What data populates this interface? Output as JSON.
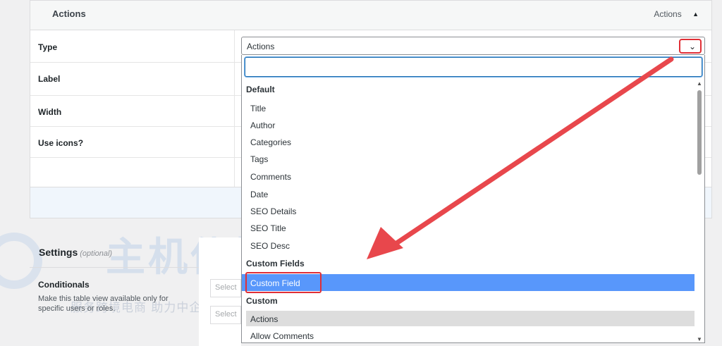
{
  "panel": {
    "title": "Actions",
    "header_right": "Actions",
    "collapse_glyph": "▲",
    "rows": [
      {
        "label": "Type"
      },
      {
        "label": "Label"
      },
      {
        "label": "Width"
      },
      {
        "label": "Use icons?"
      }
    ]
  },
  "type_select": {
    "value": "Actions",
    "chevron_glyph": "⌄",
    "search_value": "",
    "groups": [
      {
        "name": "Default",
        "options": [
          "Title",
          "Author",
          "Categories",
          "Tags",
          "Comments",
          "Date",
          "SEO Details",
          "SEO Title",
          "SEO Desc"
        ]
      },
      {
        "name": "Custom Fields",
        "options": [
          "Custom Field"
        ]
      },
      {
        "name": "Custom",
        "options": [
          "Actions",
          "Allow Comments"
        ]
      }
    ],
    "highlighted_option": "Custom Field",
    "current_option": "Actions"
  },
  "settings": {
    "title": "Settings",
    "optional_label": "(optional)",
    "conditionals_label": "Conditionals",
    "conditionals_desc": "Make this table view available only for specific users or roles.",
    "ghost_select_1": "Select",
    "ghost_select_2": "Select"
  },
  "watermark": {
    "logo_text": "主机侦探",
    "subtitle": "服务跨境电商 助力中企出海"
  },
  "colors": {
    "accent": "#2271b1",
    "highlight": "#5897fb",
    "annotation_red": "#e02f36"
  },
  "icons": {
    "chevron": "chevron-down-icon",
    "collapse": "caret-up-icon",
    "scroll_up": "scroll-up-arrow-icon",
    "scroll_down": "scroll-down-arrow-icon"
  }
}
